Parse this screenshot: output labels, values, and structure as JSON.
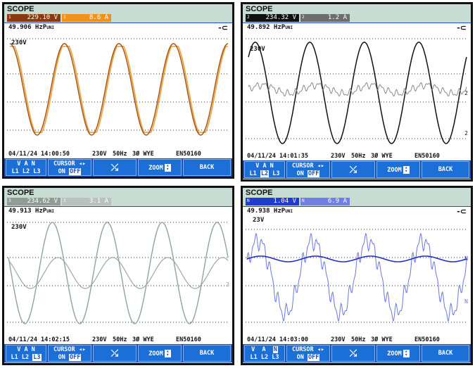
{
  "panels": [
    {
      "id": "p1",
      "title": "SCOPE",
      "readings": [
        {
          "channel": "1",
          "value": "229.10",
          "unit": "V",
          "color": "#8b3a10"
        },
        {
          "channel": "1",
          "value": "8.6",
          "unit": "A",
          "color": "#f0931e"
        }
      ],
      "frequency": "49.906 HzP",
      "freq_suffix": "UNI",
      "voltage_label": "230V",
      "wave_color": "#a35620",
      "current_color": "#f0a030",
      "status": {
        "date": "04/11/24",
        "time": "14:00:50",
        "nominal": "230V",
        "freq": "50Hz",
        "config": "3Ø WYE",
        "standard": "EN50160"
      },
      "softkeys": {
        "phase_top": "V  A  N",
        "phase_bottom": [
          "L1",
          "L2",
          "L3"
        ],
        "selected": 0,
        "cursor": "CURSOR",
        "on": "ON",
        "off": "OFF",
        "zoom": "ZOOM",
        "back": "BACK"
      }
    },
    {
      "id": "p2",
      "title": "SCOPE",
      "readings": [
        {
          "channel": "2",
          "value": "234.32",
          "unit": "V",
          "color": "#111111"
        },
        {
          "channel": "2",
          "value": "1.2",
          "unit": "A",
          "color": "#6d6d6d"
        }
      ],
      "frequency": "49.892 HzP",
      "freq_suffix": "UNI",
      "voltage_label": "230V",
      "trace_label": "2",
      "wave_color": "#111111",
      "current_color": "#8a8a8a",
      "status": {
        "date": "04/11/24",
        "time": "14:01:35",
        "nominal": "230V",
        "freq": "50Hz",
        "config": "3Ø WYE",
        "standard": "EN50160"
      },
      "softkeys": {
        "phase_top": "V  A  N",
        "phase_bottom": [
          "L1",
          "L2",
          "L3"
        ],
        "selected": 1,
        "cursor": "CURSOR",
        "on": "ON",
        "off": "OFF",
        "zoom": "ZOOM",
        "back": "BACK"
      }
    },
    {
      "id": "p3",
      "title": "SCOPE",
      "readings": [
        {
          "channel": "3",
          "value": "234.62",
          "unit": "V",
          "color": "#8f9d96"
        },
        {
          "channel": "3",
          "value": "3.1",
          "unit": "A",
          "color": "#b9c2be"
        }
      ],
      "frequency": "49.913 HzP",
      "freq_suffix": "UNI",
      "voltage_label": "230V",
      "trace_label": "3",
      "wave_color": "#8fa49a",
      "current_color": "#9aaaa3",
      "status": {
        "date": "04/11/24",
        "time": "14:02:15",
        "nominal": "230V",
        "freq": "50Hz",
        "config": "3Ø WYE",
        "standard": "EN50160"
      },
      "softkeys": {
        "phase_top": "V  A  N",
        "phase_bottom": [
          "L1",
          "L2",
          "L3"
        ],
        "selected": 2,
        "cursor": "CURSOR",
        "on": "ON",
        "off": "OFF",
        "zoom": "ZOOM",
        "back": "BACK"
      }
    },
    {
      "id": "p4",
      "title": "SCOPE",
      "readings": [
        {
          "channel": "N",
          "value": "1.04",
          "unit": "V",
          "color": "#1f3bd0"
        },
        {
          "channel": "N",
          "value": "6.9",
          "unit": "A",
          "color": "#6f7fe6"
        }
      ],
      "frequency": "49.938 HzP",
      "freq_suffix": "UNI",
      "voltage_label": "23V",
      "trace_label": "N",
      "wave_color": "#2330c8",
      "current_color": "#6a78e0",
      "status": {
        "date": "04/11/24",
        "time": "14:03:00",
        "nominal": "230V",
        "freq": "50Hz",
        "config": "3Ø WYE",
        "standard": "EN50160"
      },
      "softkeys": {
        "phase_top": "V  A  N",
        "phase_bottom": [
          "L1",
          "L2",
          "L3"
        ],
        "selected": 3,
        "cursor": "CURSOR",
        "on": "ON",
        "off": "OFF",
        "zoom": "ZOOM",
        "back": "BACK"
      }
    }
  ]
}
